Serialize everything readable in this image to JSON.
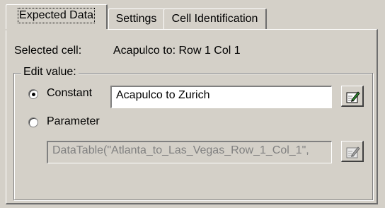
{
  "tabs": [
    {
      "label": "Expected Data",
      "active": true
    },
    {
      "label": "Settings",
      "active": false
    },
    {
      "label": "Cell Identification",
      "active": false
    }
  ],
  "selected_cell": {
    "label": "Selected cell:",
    "value": "Acapulco to: Row 1 Col 1"
  },
  "edit_value": {
    "legend": "Edit value:",
    "constant": {
      "label": "Constant",
      "checked": true,
      "value": "Acapulco to Zurich",
      "button_icon": "edit-icon"
    },
    "parameter": {
      "label": "Parameter",
      "checked": false,
      "value": "DataTable(\"Atlanta_to_Las_Vegas_Row_1_Col_1\",",
      "button_icon": "edit-icon",
      "disabled": true
    }
  }
}
